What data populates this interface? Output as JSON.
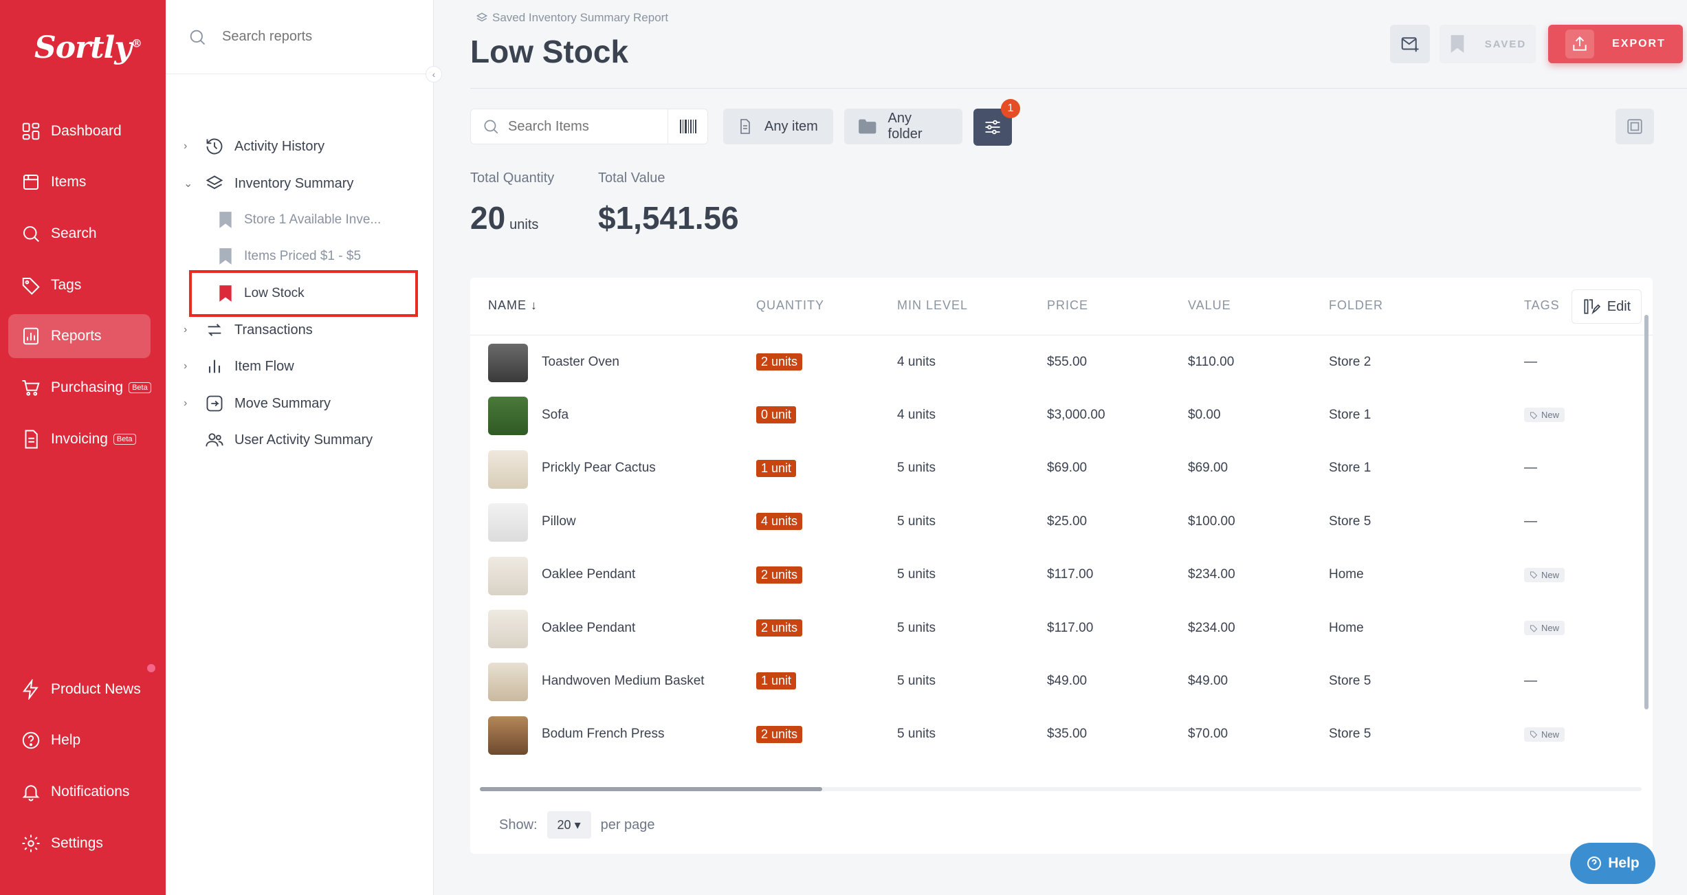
{
  "app": {
    "logo_text": "Sortly",
    "brand_color": "#dd2a3b"
  },
  "nav": {
    "items": [
      {
        "label": "Dashboard",
        "icon": "dashboard-icon"
      },
      {
        "label": "Items",
        "icon": "items-icon"
      },
      {
        "label": "Search",
        "icon": "search-icon"
      },
      {
        "label": "Tags",
        "icon": "tag-icon"
      },
      {
        "label": "Reports",
        "icon": "reports-icon",
        "active": true
      },
      {
        "label": "Purchasing",
        "icon": "cart-icon",
        "badge": "Beta"
      },
      {
        "label": "Invoicing",
        "icon": "invoice-icon",
        "badge": "Beta"
      }
    ],
    "bottom": [
      {
        "label": "Product News",
        "icon": "bolt-icon"
      },
      {
        "label": "Help",
        "icon": "help-icon"
      },
      {
        "label": "Notifications",
        "icon": "bell-icon"
      },
      {
        "label": "Settings",
        "icon": "gear-icon"
      }
    ]
  },
  "reports_panel": {
    "search_placeholder": "Search reports",
    "tree": [
      {
        "label": "Activity History",
        "icon": "history-icon"
      },
      {
        "label": "Inventory Summary",
        "icon": "layers-icon",
        "expanded": true
      },
      {
        "label": "Transactions",
        "icon": "transactions-icon"
      },
      {
        "label": "Item Flow",
        "icon": "bar-chart-icon"
      },
      {
        "label": "Move Summary",
        "icon": "move-icon"
      },
      {
        "label": "User Activity Summary",
        "icon": "users-icon"
      }
    ],
    "saved": [
      {
        "label": "Store 1 Available Inve..."
      },
      {
        "label": "Items Priced $1 - $5"
      },
      {
        "label": "Low Stock",
        "selected": true
      }
    ]
  },
  "header": {
    "breadcrumb": "Saved Inventory Summary Report",
    "title": "Low Stock",
    "saved_label": "SAVED",
    "export_label": "EXPORT"
  },
  "filters": {
    "search_placeholder": "Search Items",
    "any_item": "Any item",
    "any_folder": "Any folder",
    "filter_count": "1"
  },
  "stats": {
    "total_quantity_label": "Total Quantity",
    "total_quantity_value": "20",
    "total_quantity_unit": "units",
    "total_value_label": "Total Value",
    "total_value_value": "$1,541.56"
  },
  "table": {
    "columns": [
      "NAME",
      "QUANTITY",
      "MIN LEVEL",
      "PRICE",
      "VALUE",
      "FOLDER",
      "TAGS"
    ],
    "edit_label": "Edit",
    "rows": [
      {
        "name": "Toaster Oven",
        "quantity": "2 units",
        "min_level": "4 units",
        "price": "$55.00",
        "value": "$110.00",
        "folder": "Store 2",
        "tags": "—"
      },
      {
        "name": "Sofa",
        "quantity": "0 unit",
        "min_level": "4 units",
        "price": "$3,000.00",
        "value": "$0.00",
        "folder": "Store 1",
        "tags": "New"
      },
      {
        "name": "Prickly Pear Cactus",
        "quantity": "1 unit",
        "min_level": "5 units",
        "price": "$69.00",
        "value": "$69.00",
        "folder": "Store 1",
        "tags": "—"
      },
      {
        "name": "Pillow",
        "quantity": "4 units",
        "min_level": "5 units",
        "price": "$25.00",
        "value": "$100.00",
        "folder": "Store 5",
        "tags": "—"
      },
      {
        "name": "Oaklee Pendant",
        "quantity": "2 units",
        "min_level": "5 units",
        "price": "$117.00",
        "value": "$234.00",
        "folder": "Home",
        "tags": "New"
      },
      {
        "name": "Oaklee Pendant",
        "quantity": "2 units",
        "min_level": "5 units",
        "price": "$117.00",
        "value": "$234.00",
        "folder": "Home",
        "tags": "New"
      },
      {
        "name": "Handwoven Medium Basket",
        "quantity": "1 unit",
        "min_level": "5 units",
        "price": "$49.00",
        "value": "$49.00",
        "folder": "Store 5",
        "tags": "—"
      },
      {
        "name": "Bodum French Press",
        "quantity": "2 units",
        "min_level": "5 units",
        "price": "$35.00",
        "value": "$70.00",
        "folder": "Store 5",
        "tags": "New"
      }
    ]
  },
  "footer": {
    "show_label": "Show:",
    "per_page_value": "20",
    "per_page_label": "per page"
  },
  "help_button": "Help"
}
